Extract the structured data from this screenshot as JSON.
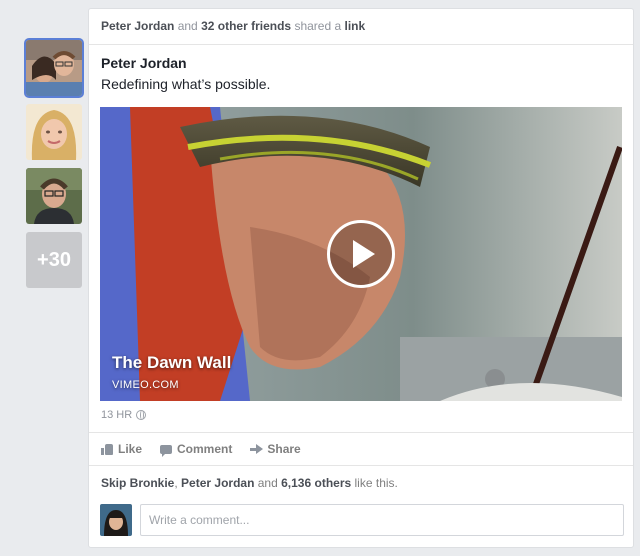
{
  "rail": {
    "more_label": "+30"
  },
  "story": {
    "actor": "Peter Jordan",
    "connector": "and",
    "others": "32 other friends",
    "verb": "shared a",
    "object": "link"
  },
  "post": {
    "author": "Peter Jordan",
    "status": "Redefining what’s possible."
  },
  "video": {
    "title": "The Dawn Wall",
    "source": "VIMEO.COM"
  },
  "meta": {
    "time": "13 HR"
  },
  "actions": {
    "like": "Like",
    "comment": "Comment",
    "share": "Share"
  },
  "likes": {
    "name1": "Skip Bronkie",
    "sep": ",",
    "name2": "Peter Jordan",
    "and": "and",
    "others": "6,136 others",
    "suffix": "like this."
  },
  "composer": {
    "placeholder": "Write a comment..."
  },
  "colors": {
    "accent": "#5b7fd6",
    "card_bg": "#ffffff",
    "page_bg": "#e9ebee"
  }
}
